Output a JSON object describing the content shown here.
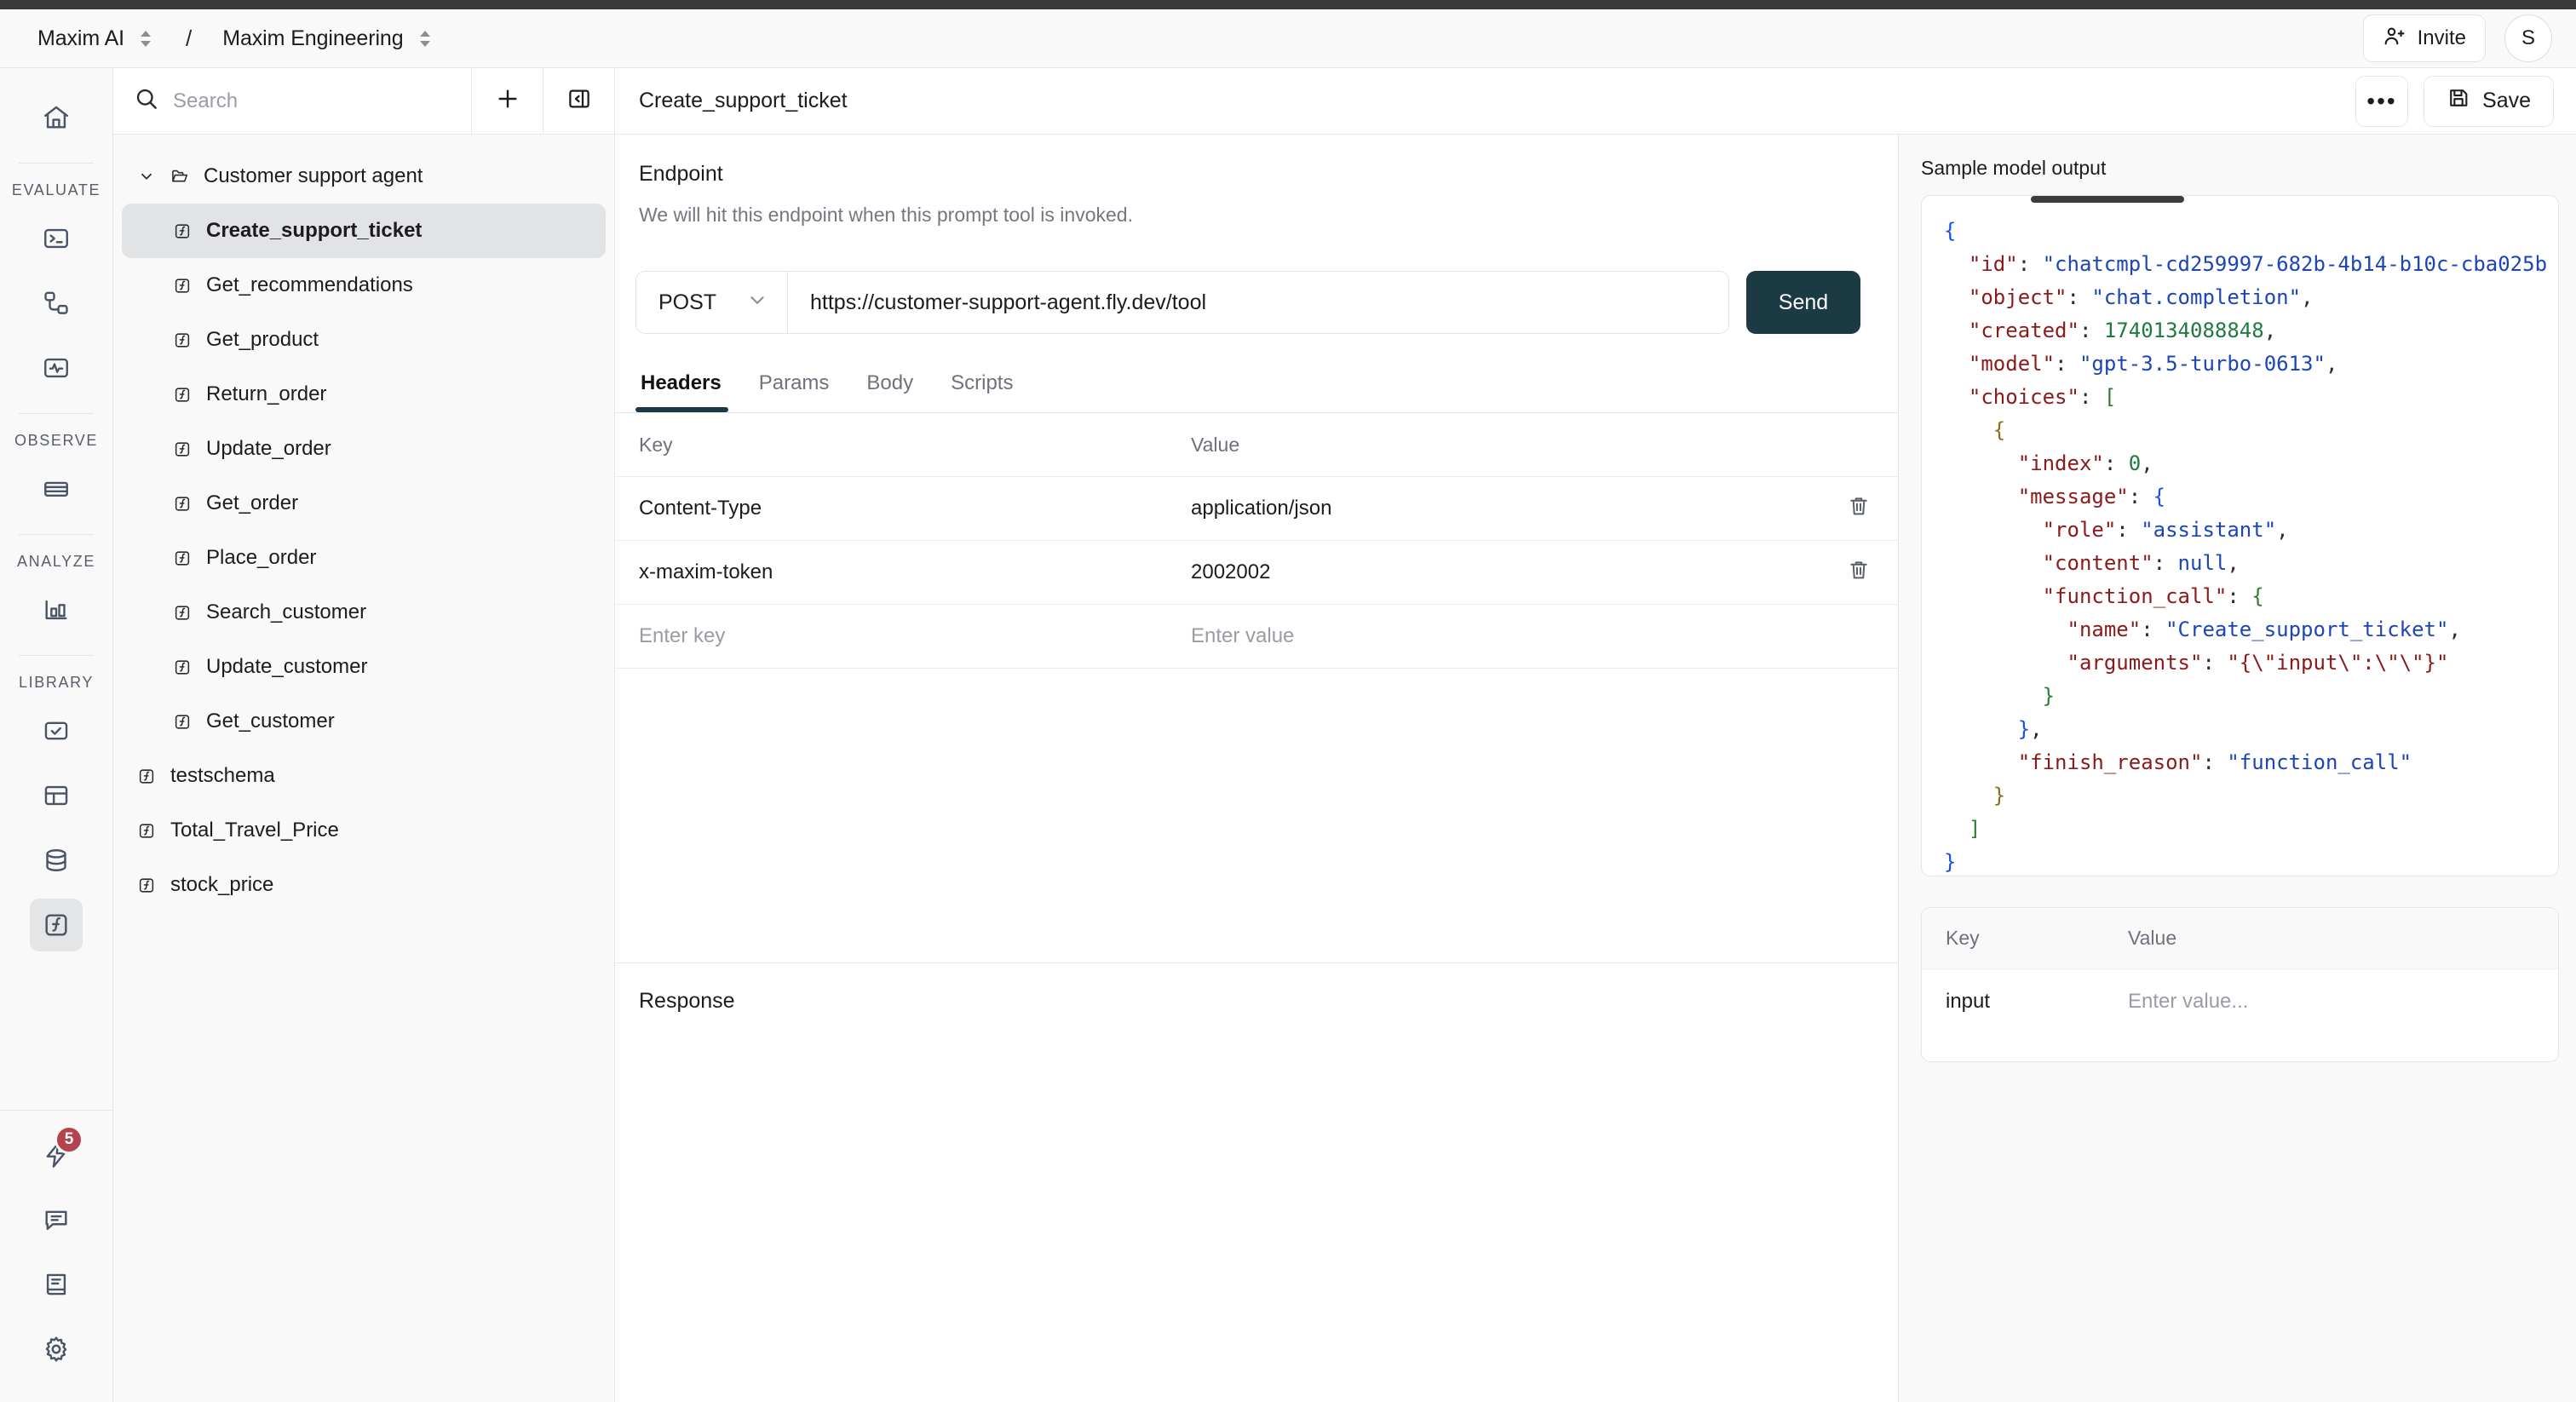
{
  "topbar": {
    "workspace": "Maxim AI",
    "separator": "/",
    "project": "Maxim Engineering",
    "invite_label": "Invite",
    "avatar_initial": "S"
  },
  "rail": {
    "home_icon": "home-icon",
    "groups": [
      {
        "label": "EVALUATE",
        "icons": [
          "terminal-icon",
          "workflow-icon",
          "pulse-icon"
        ]
      },
      {
        "label": "OBSERVE",
        "icons": [
          "logs-icon"
        ]
      },
      {
        "label": "ANALYZE",
        "icons": [
          "bar-chart-icon"
        ]
      },
      {
        "label": "LIBRARY",
        "icons": [
          "checklist-icon",
          "dataset-icon",
          "database-icon",
          "function-icon"
        ]
      }
    ],
    "bottom_icons": [
      "bolt-icon",
      "chat-icon",
      "docs-icon",
      "settings-icon"
    ],
    "bolt_badge": "5"
  },
  "sidebar": {
    "search_placeholder": "Search",
    "add_label": "+",
    "collapse_icon": "panel-collapse-icon",
    "folder": {
      "label": "Customer support agent",
      "expanded": true
    },
    "children": [
      {
        "label": "Create_support_ticket",
        "selected": true
      },
      {
        "label": "Get_recommendations",
        "selected": false
      },
      {
        "label": "Get_product",
        "selected": false
      },
      {
        "label": "Return_order",
        "selected": false
      },
      {
        "label": "Update_order",
        "selected": false
      },
      {
        "label": "Get_order",
        "selected": false
      },
      {
        "label": "Place_order",
        "selected": false
      },
      {
        "label": "Search_customer",
        "selected": false
      },
      {
        "label": "Update_customer",
        "selected": false
      },
      {
        "label": "Get_customer",
        "selected": false
      }
    ],
    "roots": [
      {
        "label": "testschema"
      },
      {
        "label": "Total_Travel_Price"
      },
      {
        "label": "stock_price"
      }
    ]
  },
  "content_header": {
    "title": "Create_support_ticket",
    "more_label": "•••",
    "save_label": "Save"
  },
  "endpoint": {
    "title": "Endpoint",
    "description": "We will hit this endpoint when this prompt tool is invoked.",
    "method": "POST",
    "url": "https://customer-support-agent.fly.dev/tool",
    "send_label": "Send"
  },
  "tabs": [
    {
      "label": "Headers",
      "active": true
    },
    {
      "label": "Params",
      "active": false
    },
    {
      "label": "Body",
      "active": false
    },
    {
      "label": "Scripts",
      "active": false
    }
  ],
  "headers_table": {
    "columns": [
      "Key",
      "Value"
    ],
    "rows": [
      {
        "key": "Content-Type",
        "value": "application/json"
      },
      {
        "key": "x-maxim-token",
        "value": "2002002"
      }
    ],
    "new_row": {
      "key_placeholder": "Enter key",
      "value_placeholder": "Enter value"
    }
  },
  "response": {
    "title": "Response",
    "body": ""
  },
  "sample_output": {
    "title": "Sample model output",
    "lines": [
      {
        "indent": 0,
        "parts": [
          {
            "t": "{",
            "c": "tok-p0"
          }
        ]
      },
      {
        "indent": 1,
        "parts": [
          {
            "t": "\"id\"",
            "c": "tok-key"
          },
          {
            "t": ": ",
            "c": "tok-punct"
          },
          {
            "t": "\"chatcmpl-cd259997-682b-4b14-b10c-cba025b",
            "c": "tok-str"
          }
        ]
      },
      {
        "indent": 1,
        "parts": [
          {
            "t": "\"object\"",
            "c": "tok-key"
          },
          {
            "t": ": ",
            "c": "tok-punct"
          },
          {
            "t": "\"chat.completion\"",
            "c": "tok-str"
          },
          {
            "t": ",",
            "c": "tok-punct"
          }
        ]
      },
      {
        "indent": 1,
        "parts": [
          {
            "t": "\"created\"",
            "c": "tok-key"
          },
          {
            "t": ": ",
            "c": "tok-punct"
          },
          {
            "t": "1740134088848",
            "c": "tok-num"
          },
          {
            "t": ",",
            "c": "tok-punct"
          }
        ]
      },
      {
        "indent": 1,
        "parts": [
          {
            "t": "\"model\"",
            "c": "tok-key"
          },
          {
            "t": ": ",
            "c": "tok-punct"
          },
          {
            "t": "\"gpt-3.5-turbo-0613\"",
            "c": "tok-str"
          },
          {
            "t": ",",
            "c": "tok-punct"
          }
        ]
      },
      {
        "indent": 1,
        "parts": [
          {
            "t": "\"choices\"",
            "c": "tok-key"
          },
          {
            "t": ": ",
            "c": "tok-punct"
          },
          {
            "t": "[",
            "c": "tok-p2"
          }
        ]
      },
      {
        "indent": 2,
        "parts": [
          {
            "t": "{",
            "c": "tok-p1"
          }
        ]
      },
      {
        "indent": 3,
        "parts": [
          {
            "t": "\"index\"",
            "c": "tok-key"
          },
          {
            "t": ": ",
            "c": "tok-punct"
          },
          {
            "t": "0",
            "c": "tok-num"
          },
          {
            "t": ",",
            "c": "tok-punct"
          }
        ]
      },
      {
        "indent": 3,
        "parts": [
          {
            "t": "\"message\"",
            "c": "tok-key"
          },
          {
            "t": ": ",
            "c": "tok-punct"
          },
          {
            "t": "{",
            "c": "tok-p0"
          }
        ]
      },
      {
        "indent": 4,
        "parts": [
          {
            "t": "\"role\"",
            "c": "tok-key"
          },
          {
            "t": ": ",
            "c": "tok-punct"
          },
          {
            "t": "\"assistant\"",
            "c": "tok-str"
          },
          {
            "t": ",",
            "c": "tok-punct"
          }
        ]
      },
      {
        "indent": 4,
        "parts": [
          {
            "t": "\"content\"",
            "c": "tok-key"
          },
          {
            "t": ": ",
            "c": "tok-punct"
          },
          {
            "t": "null",
            "c": "tok-null"
          },
          {
            "t": ",",
            "c": "tok-punct"
          }
        ]
      },
      {
        "indent": 4,
        "parts": [
          {
            "t": "\"function_call\"",
            "c": "tok-key"
          },
          {
            "t": ": ",
            "c": "tok-punct"
          },
          {
            "t": "{",
            "c": "tok-p2"
          }
        ]
      },
      {
        "indent": 5,
        "parts": [
          {
            "t": "\"name\"",
            "c": "tok-key"
          },
          {
            "t": ": ",
            "c": "tok-punct"
          },
          {
            "t": "\"Create_support_ticket\"",
            "c": "tok-str"
          },
          {
            "t": ",",
            "c": "tok-punct"
          }
        ]
      },
      {
        "indent": 5,
        "parts": [
          {
            "t": "\"arguments\"",
            "c": "tok-key"
          },
          {
            "t": ": ",
            "c": "tok-punct"
          },
          {
            "t": "\"{\\\"input\\\":\\\"\\\"}\"",
            "c": "tok-key"
          }
        ]
      },
      {
        "indent": 4,
        "parts": [
          {
            "t": "}",
            "c": "tok-p2"
          }
        ]
      },
      {
        "indent": 3,
        "parts": [
          {
            "t": "}",
            "c": "tok-p0"
          },
          {
            "t": ",",
            "c": "tok-punct"
          }
        ]
      },
      {
        "indent": 3,
        "parts": [
          {
            "t": "\"finish_reason\"",
            "c": "tok-key"
          },
          {
            "t": ": ",
            "c": "tok-punct"
          },
          {
            "t": "\"function_call\"",
            "c": "tok-str"
          }
        ]
      },
      {
        "indent": 2,
        "parts": [
          {
            "t": "}",
            "c": "tok-p1"
          }
        ]
      },
      {
        "indent": 1,
        "parts": [
          {
            "t": "]",
            "c": "tok-p2"
          }
        ]
      },
      {
        "indent": 0,
        "parts": [
          {
            "t": "}",
            "c": "tok-p0"
          }
        ]
      }
    ]
  },
  "variables_table": {
    "columns": [
      "Key",
      "Value"
    ],
    "rows": [
      {
        "key": "input",
        "value_placeholder": "Enter value..."
      }
    ]
  },
  "colors": {
    "accent": "#1b3a44",
    "badge": "#b3434d",
    "panel_bg": "#f9f9fa",
    "border": "#e6e7e9",
    "icon_stroke": "#4b5465"
  }
}
